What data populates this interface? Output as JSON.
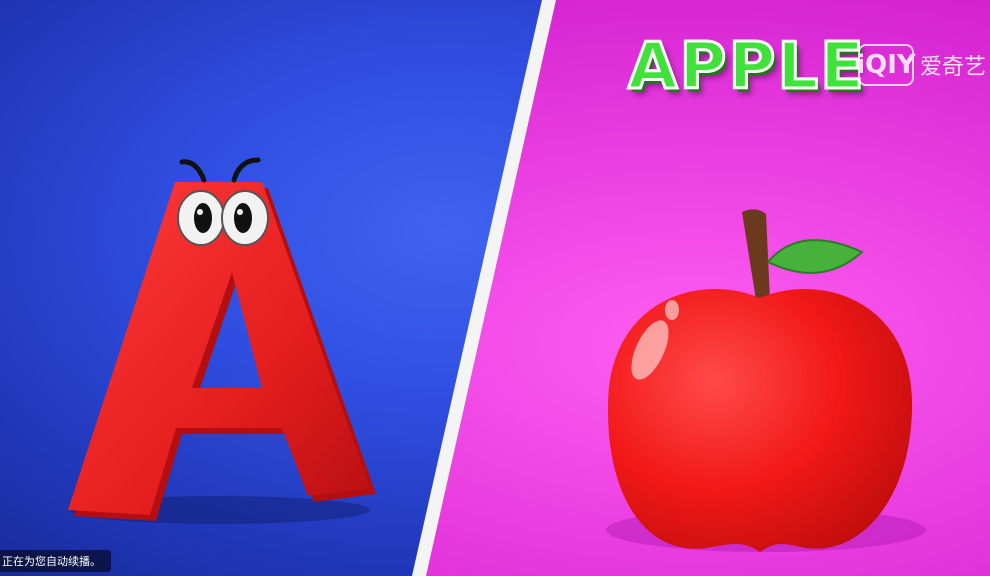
{
  "video": {
    "word": "APPLE",
    "watermark_logo": "iQIY",
    "watermark_text": "爱奇艺",
    "toast": "正在为您自动续播。"
  },
  "colors": {
    "left_bg": "#2f4ee0",
    "right_bg": "#ea3ee0",
    "letter_red": "#e51e1e",
    "word_green": "#3fe13a",
    "leaf_green": "#46b23c"
  },
  "icons": {
    "watermark": "iqiyi-logo-icon"
  }
}
